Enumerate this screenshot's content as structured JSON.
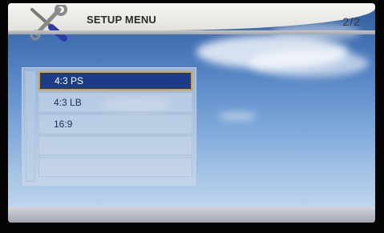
{
  "header": {
    "title": "SETUP MENU",
    "page_indicator": "2/2",
    "logo_icon": "tools-icon"
  },
  "menu": {
    "selected_index": 0,
    "items": [
      {
        "label": "4:3 PS"
      },
      {
        "label": "4:3 LB"
      },
      {
        "label": "16:9"
      },
      {
        "label": ""
      },
      {
        "label": ""
      }
    ]
  },
  "colors": {
    "header": "#e9e7e1",
    "selection": "#1d3c86",
    "selection_border": "#d6a02a",
    "sky": "#5a86c4"
  }
}
